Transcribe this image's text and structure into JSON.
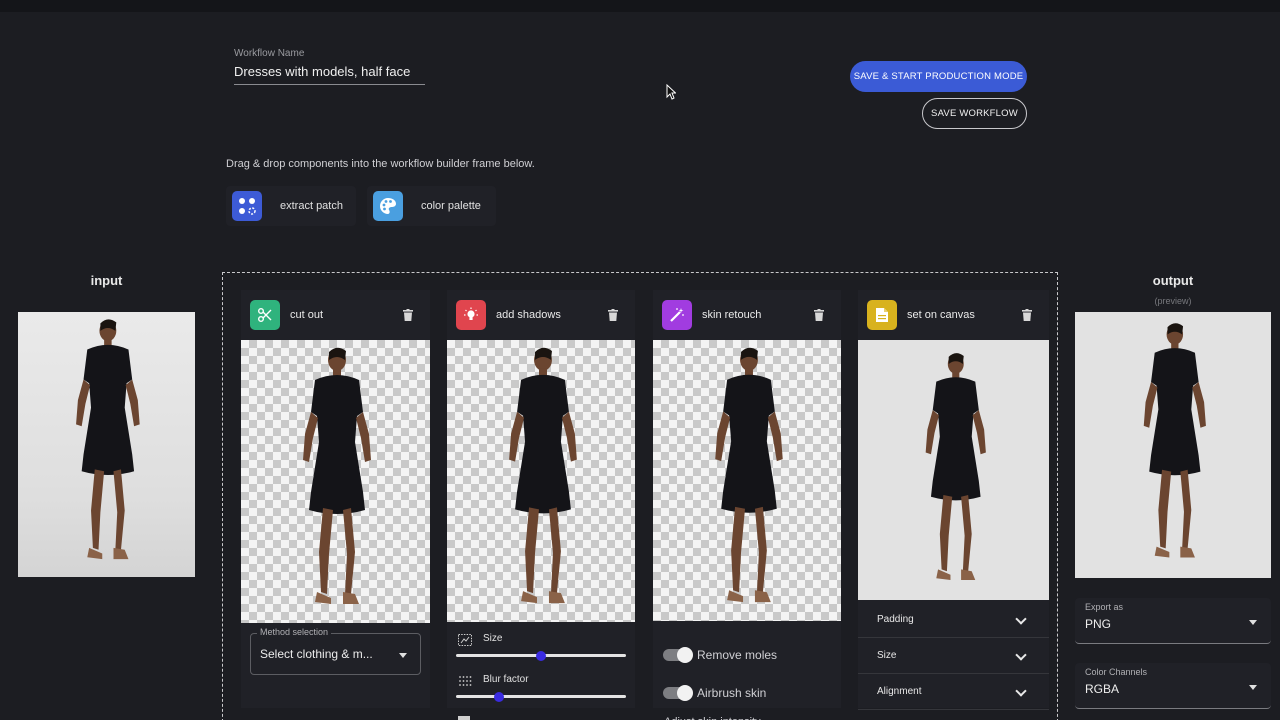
{
  "workflow": {
    "label": "Workflow Name",
    "value": "Dresses with models, half face"
  },
  "actions": {
    "primary": "SAVE & START PRODUCTION MODE",
    "secondary": "SAVE WORKFLOW"
  },
  "hint": "Drag & drop components into the workflow builder frame below.",
  "palette": [
    {
      "label": "extract patch",
      "icon": "extract-patch-icon",
      "color": "#3d5bd6"
    },
    {
      "label": "color palette",
      "icon": "palette-icon",
      "color": "#4a9fe0"
    }
  ],
  "input": {
    "title": "input"
  },
  "output": {
    "title": "output",
    "subtitle": "(preview)"
  },
  "steps": [
    {
      "label": "cut out",
      "icon": "scissors-icon",
      "color": "#2fb37d"
    },
    {
      "label": "add shadows",
      "icon": "lightbulb-icon",
      "color": "#e0454e"
    },
    {
      "label": "skin retouch",
      "icon": "magic-wand-icon",
      "color": "#a13ce0"
    },
    {
      "label": "set on canvas",
      "icon": "document-icon",
      "color": "#d8b21e"
    }
  ],
  "cutout": {
    "method_label": "Method selection",
    "method_value": "Select clothing & m..."
  },
  "shadows": {
    "sliders": [
      {
        "label": "Size",
        "value": 0.5
      },
      {
        "label": "Blur factor",
        "value": 0.25
      }
    ]
  },
  "retouch": {
    "toggles": [
      {
        "label": "Remove moles",
        "on": true
      },
      {
        "label": "Airbrush skin",
        "on": true
      }
    ],
    "truncated_label": "Adjust skin intensity"
  },
  "canvas": {
    "settings": [
      "Padding",
      "Size",
      "Alignment"
    ]
  },
  "export": {
    "format_label": "Export as",
    "format_value": "PNG",
    "channels_label": "Color Channels",
    "channels_value": "RGBA"
  },
  "colors": {
    "accent": "#3b5bd6",
    "background": "#1c1d22",
    "panel": "#202127",
    "slider_thumb": "#3a2be0"
  }
}
